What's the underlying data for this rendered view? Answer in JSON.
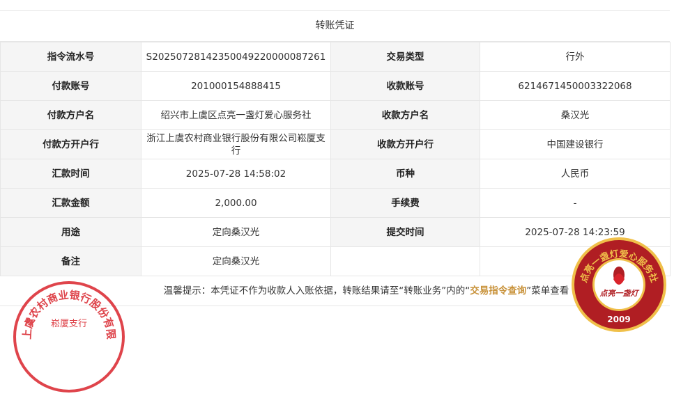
{
  "title": "转账凭证",
  "rows": [
    {
      "l1": "指令流水号",
      "v1": "S20250728142350049220000087261",
      "l2": "交易类型",
      "v2": "行外"
    },
    {
      "l1": "付款账号",
      "v1": "201000154888415",
      "l2": "收款账号",
      "v2": "6214671450003322068"
    },
    {
      "l1": "付款方户名",
      "v1": "绍兴市上虞区点亮一盏灯爱心服务社",
      "l2": "收款方户名",
      "v2": "桑汉光"
    },
    {
      "l1": "付款方开户行",
      "v1": "浙江上虞农村商业银行股份有限公司崧厦支行",
      "l2": "收款方开户行",
      "v2": "中国建设银行"
    },
    {
      "l1": "汇款时间",
      "v1": "2025-07-28 14:58:02",
      "l2": "币种",
      "v2": "人民币"
    },
    {
      "l1": "汇款金额",
      "v1": "2,000.00",
      "l2": "手续费",
      "v2": "-"
    },
    {
      "l1": "用途",
      "v1": "定向桑汉光",
      "l2": "提交时间",
      "v2": "2025-07-28 14:23:59"
    },
    {
      "l1": "备注",
      "v1": "定向桑汉光",
      "l2": "",
      "v2": ""
    }
  ],
  "tip": {
    "prefix": "温馨提示：本凭证不作为收款人入账依据，转账结果请至“转账业务”内的“",
    "highlight": "交易指令查询",
    "suffix": "”菜单查看"
  },
  "seals": {
    "bank": {
      "ring_text": "浙江上虞农村商业银行股份有限公司",
      "inner_text": "崧厦支行",
      "color": "#d9232b"
    },
    "charity": {
      "ring_text": "点亮一盏灯爱心服务社",
      "center_text": "点亮一盏灯",
      "year": "2009",
      "color": "#b01e23",
      "gold": "#f0c04a"
    }
  }
}
